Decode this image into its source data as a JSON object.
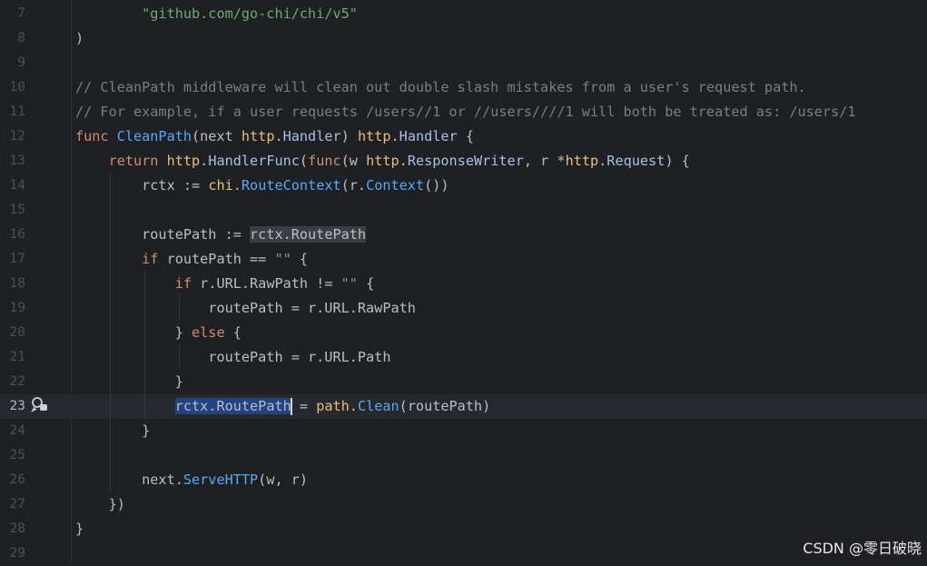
{
  "editor": {
    "lines": [
      {
        "num": "7",
        "tokens": [
          {
            "t": "        ",
            "c": ""
          },
          {
            "t": "\"github.com/go-chi/chi/v5\"",
            "c": "t-str"
          }
        ]
      },
      {
        "num": "8",
        "tokens": [
          {
            "t": ")",
            "c": ""
          }
        ]
      },
      {
        "num": "9",
        "tokens": []
      },
      {
        "num": "10",
        "tokens": [
          {
            "t": "// CleanPath middleware will clean out double slash mistakes from a user's request path.",
            "c": "t-cm"
          }
        ]
      },
      {
        "num": "11",
        "tokens": [
          {
            "t": "// For example, if a user requests /users//1 or //users////1 will both be treated as: /users/1",
            "c": "t-cm"
          }
        ]
      },
      {
        "num": "12",
        "tokens": [
          {
            "t": "func ",
            "c": "t-kw"
          },
          {
            "t": "CleanPath",
            "c": "t-fn"
          },
          {
            "t": "(next ",
            "c": ""
          },
          {
            "t": "http",
            "c": "t-pkg"
          },
          {
            "t": ".",
            "c": ""
          },
          {
            "t": "Handler",
            "c": "t-ty"
          },
          {
            "t": ") ",
            "c": ""
          },
          {
            "t": "http",
            "c": "t-pkg"
          },
          {
            "t": ".",
            "c": ""
          },
          {
            "t": "Handler",
            "c": "t-ty"
          },
          {
            "t": " {",
            "c": ""
          }
        ]
      },
      {
        "num": "13",
        "tokens": [
          {
            "t": "    ",
            "c": ""
          },
          {
            "t": "return ",
            "c": "t-kw"
          },
          {
            "t": "http",
            "c": "t-pkg"
          },
          {
            "t": ".",
            "c": ""
          },
          {
            "t": "HandlerFunc",
            "c": "t-ty"
          },
          {
            "t": "(",
            "c": ""
          },
          {
            "t": "func",
            "c": "t-kw"
          },
          {
            "t": "(w ",
            "c": ""
          },
          {
            "t": "http",
            "c": "t-pkg"
          },
          {
            "t": ".",
            "c": ""
          },
          {
            "t": "ResponseWriter",
            "c": "t-ty"
          },
          {
            "t": ", r *",
            "c": ""
          },
          {
            "t": "http",
            "c": "t-pkg"
          },
          {
            "t": ".",
            "c": ""
          },
          {
            "t": "Request",
            "c": "t-ty"
          },
          {
            "t": ") {",
            "c": ""
          }
        ]
      },
      {
        "num": "14",
        "tokens": [
          {
            "t": "        rctx := ",
            "c": ""
          },
          {
            "t": "chi",
            "c": "t-pkg"
          },
          {
            "t": ".",
            "c": ""
          },
          {
            "t": "RouteContext",
            "c": "t-mc"
          },
          {
            "t": "(r.",
            "c": ""
          },
          {
            "t": "Context",
            "c": "t-mc"
          },
          {
            "t": "())",
            "c": ""
          }
        ]
      },
      {
        "num": "15",
        "tokens": []
      },
      {
        "num": "16",
        "tokens": [
          {
            "t": "        routePath := ",
            "c": ""
          },
          {
            "t": "rctx.RoutePath",
            "c": "t-fd sel-gray"
          }
        ]
      },
      {
        "num": "17",
        "tokens": [
          {
            "t": "        ",
            "c": ""
          },
          {
            "t": "if ",
            "c": "t-kw"
          },
          {
            "t": "routePath == ",
            "c": ""
          },
          {
            "t": "\"\"",
            "c": "t-str"
          },
          {
            "t": " {",
            "c": ""
          }
        ]
      },
      {
        "num": "18",
        "tokens": [
          {
            "t": "            ",
            "c": ""
          },
          {
            "t": "if ",
            "c": "t-kw"
          },
          {
            "t": "r.URL.RawPath != ",
            "c": ""
          },
          {
            "t": "\"\"",
            "c": "t-str"
          },
          {
            "t": " {",
            "c": ""
          }
        ]
      },
      {
        "num": "19",
        "tokens": [
          {
            "t": "                routePath = r.URL.RawPath",
            "c": ""
          }
        ]
      },
      {
        "num": "20",
        "tokens": [
          {
            "t": "            } ",
            "c": ""
          },
          {
            "t": "else",
            "c": "t-kw"
          },
          {
            "t": " {",
            "c": ""
          }
        ]
      },
      {
        "num": "21",
        "tokens": [
          {
            "t": "                routePath = r.URL.Path",
            "c": ""
          }
        ]
      },
      {
        "num": "22",
        "tokens": [
          {
            "t": "            }",
            "c": ""
          }
        ]
      },
      {
        "num": "23",
        "current": true,
        "tokens": [
          {
            "t": "            ",
            "c": ""
          },
          {
            "t": "rctx.RoutePath",
            "c": "t-fd sel-blue"
          },
          {
            "t": "",
            "c": "caret"
          },
          {
            "t": " = ",
            "c": ""
          },
          {
            "t": "path",
            "c": "t-pkg"
          },
          {
            "t": ".",
            "c": ""
          },
          {
            "t": "Clean",
            "c": "t-mc"
          },
          {
            "t": "(routePath)",
            "c": ""
          }
        ]
      },
      {
        "num": "24",
        "tokens": [
          {
            "t": "        }",
            "c": ""
          }
        ]
      },
      {
        "num": "25",
        "tokens": []
      },
      {
        "num": "26",
        "tokens": [
          {
            "t": "        next.",
            "c": ""
          },
          {
            "t": "ServeHTTP",
            "c": "t-mc"
          },
          {
            "t": "(w, r)",
            "c": ""
          }
        ]
      },
      {
        "num": "27",
        "tokens": [
          {
            "t": "    })",
            "c": ""
          }
        ]
      },
      {
        "num": "28",
        "tokens": [
          {
            "t": "}",
            "c": ""
          }
        ]
      },
      {
        "num": "29",
        "tokens": []
      }
    ]
  },
  "gutter_icon": "ai-assistant-icon",
  "watermark": "CSDN @零日破晓"
}
